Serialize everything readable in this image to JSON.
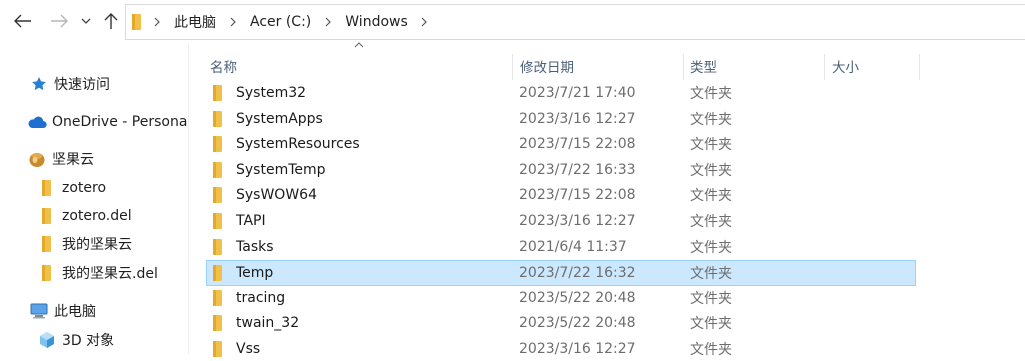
{
  "toolbar": {
    "icons": [
      "arrow-left-icon",
      "arrow-right-icon",
      "chevron-down-icon",
      "arrow-up-icon",
      "folder-icon"
    ]
  },
  "address_bar": {
    "crumbs": [
      "此电脑",
      "Acer (C:)",
      "Windows"
    ]
  },
  "nav_pane": {
    "items": [
      {
        "label": "快速访问",
        "icon": "star-icon"
      },
      {
        "label": "OneDrive - Persona",
        "icon": "cloud-icon"
      },
      {
        "label": "坚果云",
        "icon": "nut-icon"
      },
      {
        "label": "zotero",
        "icon": "folder-icon"
      },
      {
        "label": "zotero.del",
        "icon": "folder-icon"
      },
      {
        "label": "我的坚果云",
        "icon": "folder-icon"
      },
      {
        "label": "我的坚果云.del",
        "icon": "folder-icon"
      },
      {
        "label": "此电脑",
        "icon": "computer-icon"
      },
      {
        "label": "3D 对象",
        "icon": "cube-icon"
      }
    ]
  },
  "columns": {
    "name": "名称",
    "date": "修改日期",
    "type": "类型",
    "size": "大小"
  },
  "files": [
    {
      "name": "System32",
      "date": "2023/7/21 17:40",
      "type": "文件夹"
    },
    {
      "name": "SystemApps",
      "date": "2023/3/16 12:27",
      "type": "文件夹"
    },
    {
      "name": "SystemResources",
      "date": "2023/7/15 22:08",
      "type": "文件夹"
    },
    {
      "name": "SystemTemp",
      "date": "2023/7/22 16:33",
      "type": "文件夹"
    },
    {
      "name": "SysWOW64",
      "date": "2023/7/15 22:08",
      "type": "文件夹"
    },
    {
      "name": "TAPI",
      "date": "2023/3/16 12:27",
      "type": "文件夹"
    },
    {
      "name": "Tasks",
      "date": "2021/6/4 11:37",
      "type": "文件夹"
    },
    {
      "name": "Temp",
      "date": "2023/7/22 16:32",
      "type": "文件夹",
      "selected": true
    },
    {
      "name": "tracing",
      "date": "2023/5/22 20:48",
      "type": "文件夹"
    },
    {
      "name": "twain_32",
      "date": "2023/5/22 20:48",
      "type": "文件夹"
    },
    {
      "name": "Vss",
      "date": "2023/3/16 12:27",
      "type": "文件夹"
    }
  ],
  "colors": {
    "folder": "#f0c04a",
    "selection_bg": "#cce8ff",
    "selection_border": "#99d1ff",
    "header_text": "#4c607a"
  }
}
